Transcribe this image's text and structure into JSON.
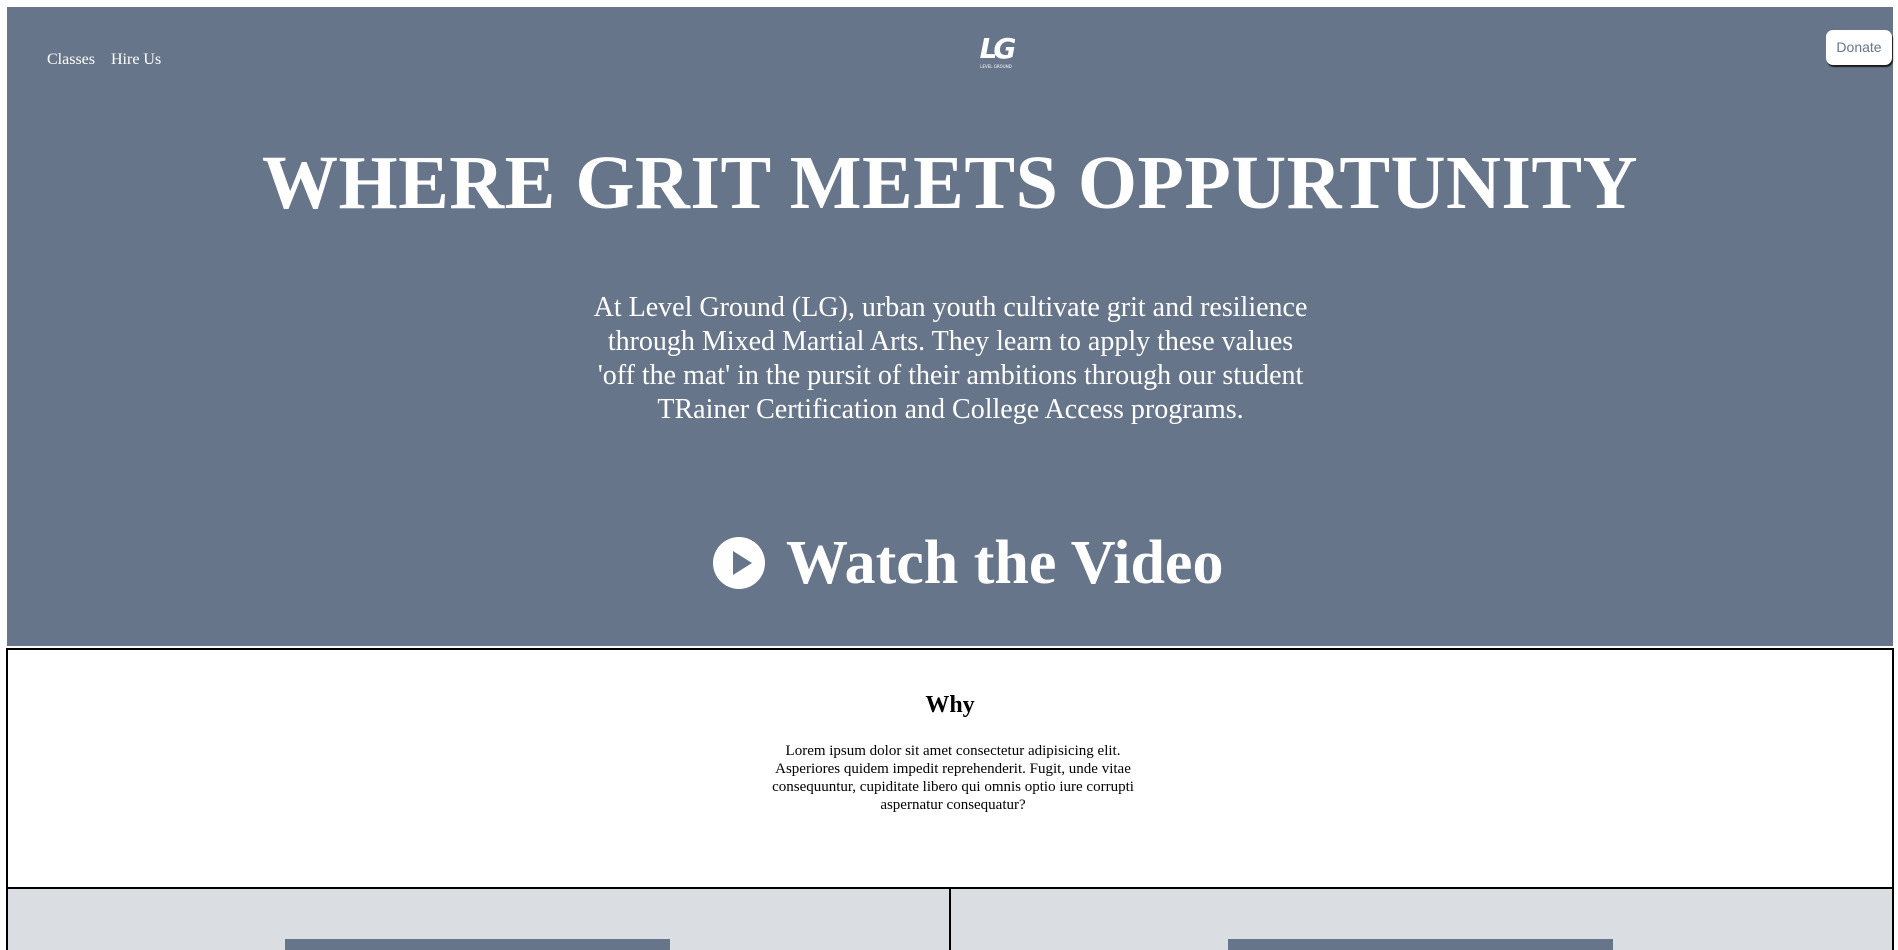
{
  "nav": {
    "items": [
      {
        "label": "Classes"
      },
      {
        "label": "Hire Us"
      }
    ]
  },
  "logo": {
    "mark": "LG",
    "subtext": "LEVEL GROUND"
  },
  "donate_label": "Donate",
  "hero": {
    "headline": "WHERE GRIT MEETS OPPURTUNITY",
    "intro": "At Level Ground (LG), urban youth cultivate grit and resilience through Mixed Martial Arts. They learn to apply these values 'off the mat' in the pursit of their ambitions through our student TRainer Certification and College Access programs.",
    "watch_label": "Watch the Video",
    "watch_icon": "play-circle-icon"
  },
  "why": {
    "title": "Why",
    "text": "Lorem ipsum dolor sit amet consectetur adipisicing elit. Asperiores quidem impedit reprehenderit. Fugit, unde vitae consequuntur, cupiditate libero qui omnis optio iure corrupti aspernatur consequatur?"
  },
  "colors": {
    "hero_bg": "#66758a",
    "card_bg": "#dadee2",
    "text_light": "#ffffff",
    "border": "#000000"
  }
}
